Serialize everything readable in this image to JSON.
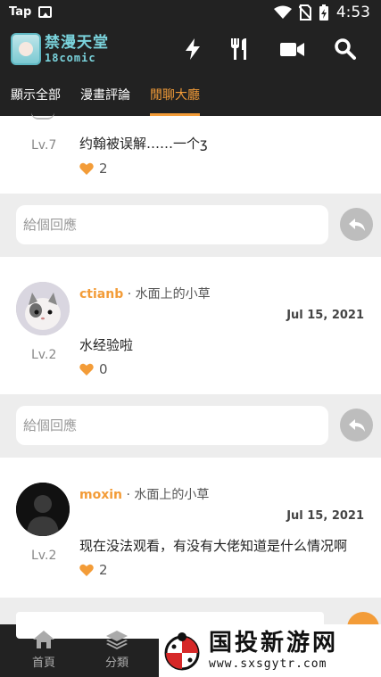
{
  "status_bar": {
    "carrier": "Tap",
    "time": "4:53",
    "icons": [
      "image-icon",
      "wifi-icon",
      "no-sim-icon",
      "battery-charging-icon"
    ]
  },
  "app_bar": {
    "logo_cn": "禁漫天堂",
    "logo_en": "18comic",
    "actions": [
      "flash-icon",
      "fork-knife-icon",
      "video-camera-icon",
      "search-icon"
    ]
  },
  "tabs": [
    {
      "label": "顯示全部",
      "active": false
    },
    {
      "label": "漫畫評論",
      "active": false
    },
    {
      "label": "閒聊大廳",
      "active": true
    }
  ],
  "comments": [
    {
      "level": "Lv.7",
      "text": "约翰被误解……一个ʒ",
      "likes": "2",
      "reply_placeholder": "給個回應"
    },
    {
      "username": "ctianb",
      "separator": "·",
      "title": "水面上的小草",
      "date": "Jul 15, 2021",
      "level": "Lv.2",
      "text": "水经验啦",
      "likes": "0",
      "reply_placeholder": "給個回應"
    },
    {
      "username": "moxin",
      "separator": "·",
      "title": "水面上的小草",
      "date": "Jul 15, 2021",
      "level": "Lv.2",
      "text": "现在没法观看，有没有大佬知道是什么情况啊",
      "likes": "2"
    }
  ],
  "bottom_nav": [
    {
      "label": "首頁",
      "icon": "home-icon"
    },
    {
      "label": "分類",
      "icon": "layers-icon"
    }
  ],
  "watermark": {
    "name": "国投新游网",
    "url": "www.sxsgytr.com"
  },
  "colors": {
    "accent": "#f39c38",
    "bar_bg": "#222222",
    "page_bg": "#ededed"
  }
}
